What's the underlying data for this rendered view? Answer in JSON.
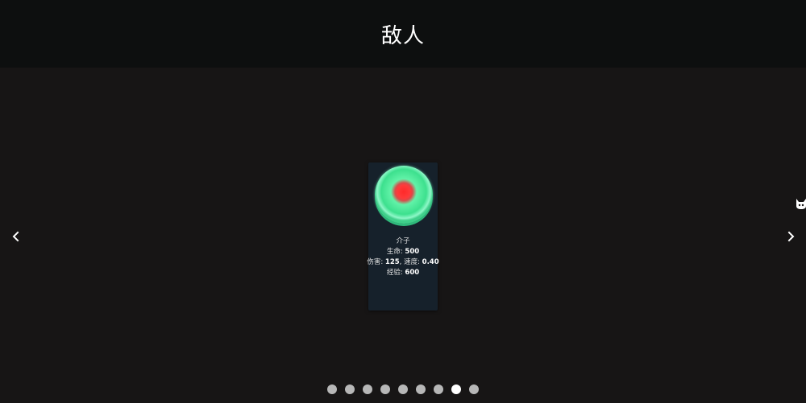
{
  "header": {
    "title": "敌人"
  },
  "enemy": {
    "name": "介子",
    "hp_label": "生命:",
    "hp_value": "500",
    "damage_label": "伤害:",
    "damage_value": "125",
    "speed_label": ", 速度:",
    "speed_value": "0.40",
    "exp_label": "经验:",
    "exp_value": "600",
    "image_icon": "meson-orb-icon"
  },
  "carousel": {
    "prev_icon": "chevron-left-icon",
    "next_icon": "chevron-right-icon",
    "page_count": 9,
    "active_page": 8
  },
  "colors": {
    "header_bg": "#0d0f0f",
    "body_bg": "#171515",
    "card_bg": "#16212b",
    "dot_inactive": "#b7b7b7",
    "dot_active": "#ffffff"
  }
}
